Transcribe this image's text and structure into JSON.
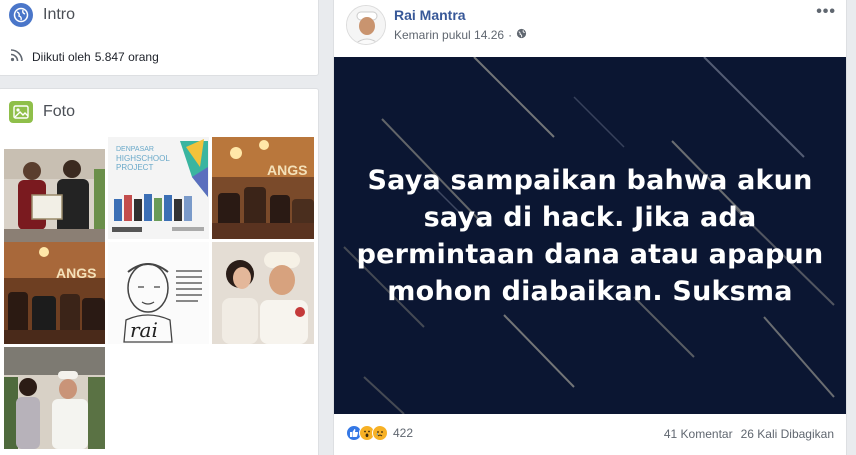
{
  "intro": {
    "title": "Intro",
    "followed_label": "Diikuti oleh",
    "followed_count": "5.847 orang"
  },
  "photos": {
    "title": "Foto",
    "poster_heading": "DENPASAR",
    "poster_line1": "HIGHSCHOOL",
    "poster_line2": "PROJECT"
  },
  "post": {
    "author": "Rai Mantra",
    "timestamp": "Kemarin pukul 14.26",
    "separator": "·",
    "more": "•••",
    "message_lines": [
      "Saya sampaikan bahwa akun",
      "saya di hack. Jika ada",
      "permintaan dana atau apapun",
      "mohon diabaikan. Suksma"
    ],
    "reaction_count": "422",
    "comments": "41 Komentar",
    "shares": "26 Kali Dibagikan"
  },
  "colors": {
    "link_blue": "#385898",
    "banner_bg": "#0b1632",
    "page_bg": "#e9ebee"
  }
}
